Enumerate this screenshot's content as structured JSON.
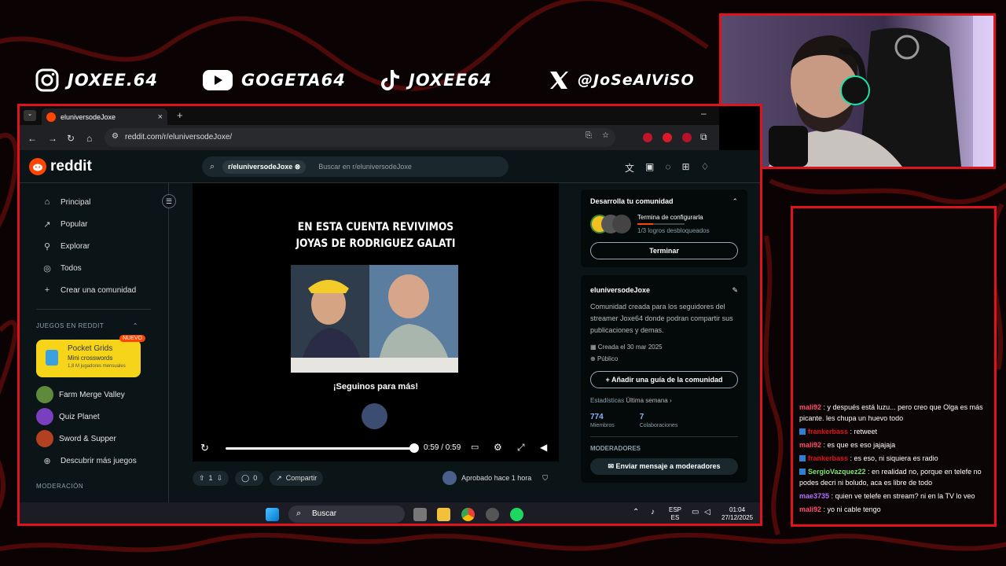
{
  "colors": {
    "frame_red": "#e0121b",
    "reddit_orange": "#ff4500",
    "link_blue": "#8ab4f8"
  },
  "socials": [
    {
      "icon": "instagram-icon",
      "handle": "JOXEE.64"
    },
    {
      "icon": "youtube-icon",
      "handle": "GOGETA64"
    },
    {
      "icon": "tiktok-icon",
      "handle": "JOXEE64"
    },
    {
      "icon": "x-icon",
      "handle": "@JoSeAlViSO"
    }
  ],
  "browser": {
    "tab_title": "eluniversodeJoxe",
    "url": "reddit.com/r/eluniversodeJoxe/"
  },
  "reddit": {
    "brand": "reddit",
    "search_chip": "r/eluniversodeJoxe",
    "search_placeholder": "Buscar en r/eluniversodeJoxe",
    "nav": [
      {
        "icon": "home-icon",
        "label": "Principal"
      },
      {
        "icon": "popular-icon",
        "label": "Popular"
      },
      {
        "icon": "explore-icon",
        "label": "Explorar"
      },
      {
        "icon": "all-icon",
        "label": "Todos"
      },
      {
        "icon": "plus-icon",
        "label": "Crear una comunidad"
      }
    ],
    "games_section": "JUEGOS EN REDDIT",
    "featured_game": {
      "title": "Pocket Grids",
      "subtitle": "Mini crosswords",
      "users": "1,8 M jugadores mensuales",
      "badge": "NUEVO"
    },
    "games": [
      {
        "label": "Farm Merge Valley",
        "color": "#5f8a3c"
      },
      {
        "label": "Quiz Planet",
        "color": "#7a3fbf"
      },
      {
        "label": "Sword & Supper",
        "color": "#b34020"
      }
    ],
    "more_games": "Descubrir más juegos",
    "moderation_section": "MODERACIÓN",
    "video": {
      "title_line1": "EN ESTA CUENTA REVIVIMOS",
      "title_line2": "JOYAS DE RODRIGUEZ GALATI",
      "subtitle": "¡Seguinos para más!",
      "time": "0:59 / 0:59",
      "progress": 1.0
    },
    "post": {
      "votes": "1",
      "comments": "0",
      "share": "Compartir",
      "approved": "Aprobado hace 1 hora"
    },
    "community_card": {
      "title": "Desarrolla tu comunidad",
      "task": "Termina de configurarla",
      "progress_text": "1/3 logros desbloqueados",
      "button": "Terminar"
    },
    "about": {
      "name": "eluniversodeJoxe",
      "description": "Comunidad creada para los seguidores del streamer Joxe64 donde podran compartir sus publicaciones y demas.",
      "created": "Creada el 30 mar 2025",
      "visibility": "Público",
      "guide_button": "Añadir una guía de la comunidad",
      "stats_label": "Estadísticas",
      "stats_period": "Última semana",
      "members": "774",
      "members_label": "Miembros",
      "contributions": "7",
      "contributions_label": "Colaboraciones",
      "moderators_label": "MODERADORES",
      "message_mods": "Enviar mensaje a moderadores"
    }
  },
  "taskbar": {
    "search": "Buscar",
    "lang_top": "ESP",
    "lang_bottom": "ES",
    "time": "01:04",
    "date": "27/12/2025"
  },
  "chat": [
    {
      "user": "mali92",
      "color": "#ff4d6d",
      "badge": false,
      "text": "y después está luzu... pero creo que Olga es más picante. les chupa un huevo todo"
    },
    {
      "user": "frankerbass",
      "color": "#e0121b",
      "badge": true,
      "text": "retweet"
    },
    {
      "user": "mali92",
      "color": "#ff4d6d",
      "badge": false,
      "text": "es que es eso jajajaja"
    },
    {
      "user": "frankerbass",
      "color": "#e0121b",
      "badge": true,
      "text": "es eso, ni siquiera es radio"
    },
    {
      "user": "SergioVazquez22",
      "color": "#7be36b",
      "badge": true,
      "text": "en realidad no, porque en telefe no podes decri ni boludo, aca es libre de todo"
    },
    {
      "user": "mae3735",
      "color": "#b072ff",
      "badge": false,
      "text": "quien ve telefe en stream? ni en la TV lo veo"
    },
    {
      "user": "mali92",
      "color": "#ff4d6d",
      "badge": false,
      "text": "yo ni cable tengo"
    }
  ]
}
